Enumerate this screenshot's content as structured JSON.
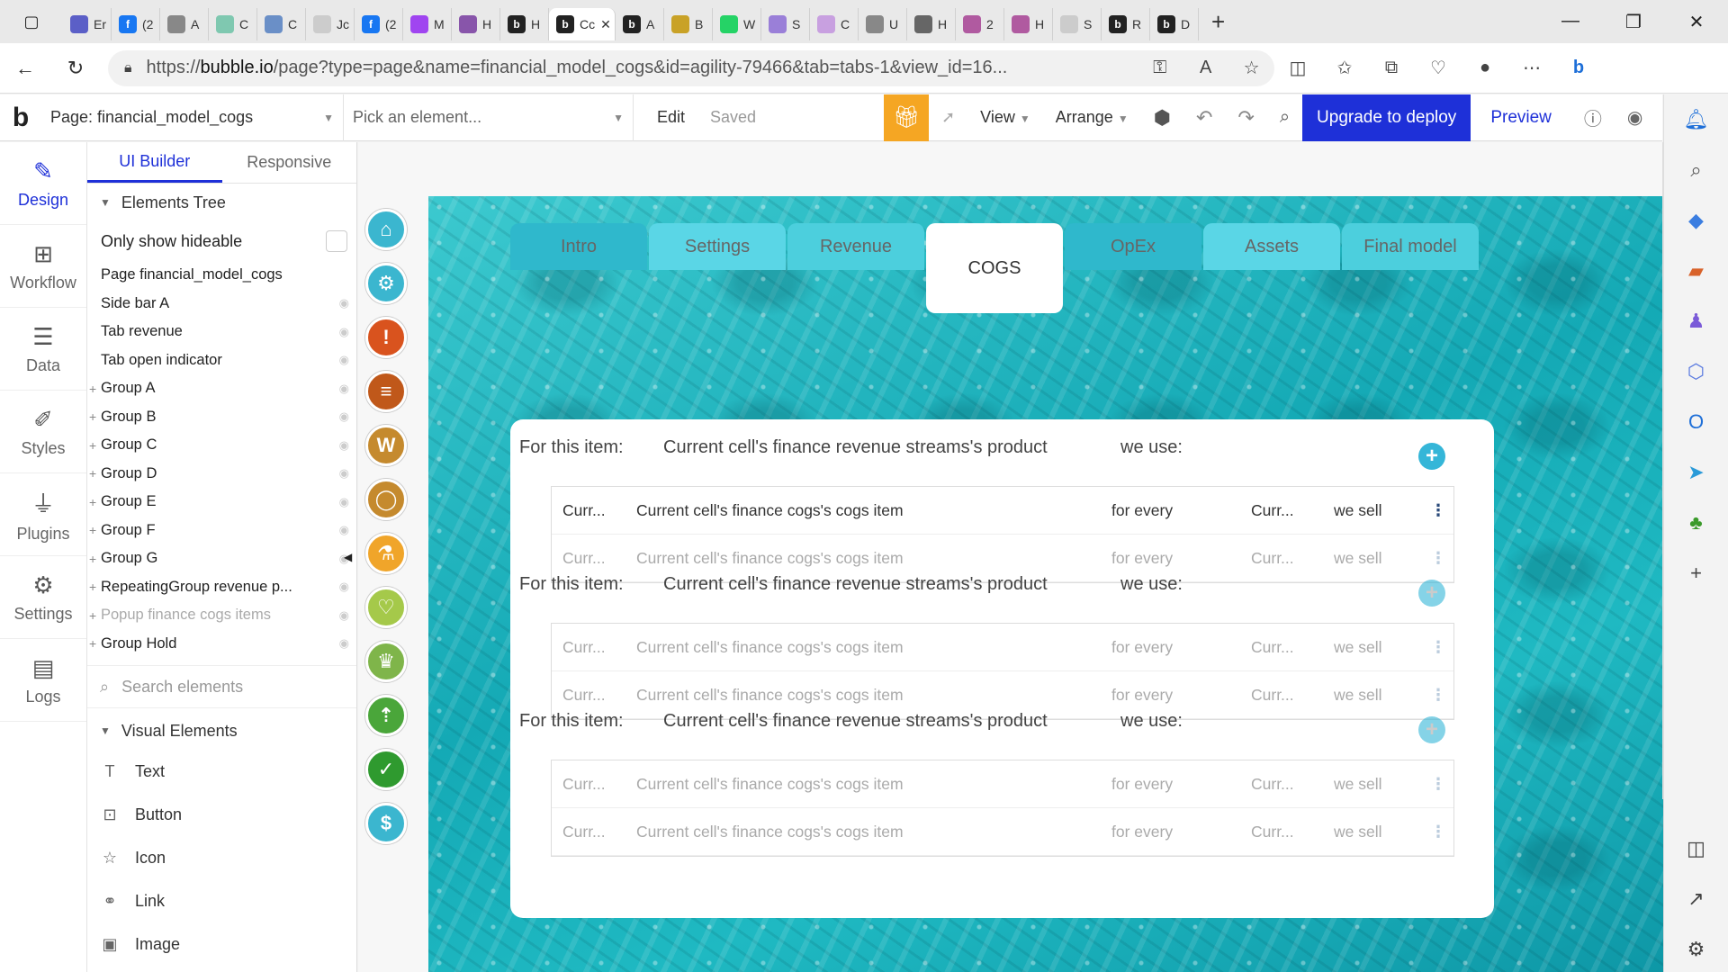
{
  "browser": {
    "tabs": [
      {
        "label": "Er",
        "icon": "teams-icon",
        "color": "#5b5fc7"
      },
      {
        "label": "(2",
        "icon": "facebook-icon",
        "color": "#1877f2"
      },
      {
        "label": "A",
        "icon": "doc-icon",
        "color": "#888888"
      },
      {
        "label": "C",
        "icon": "globe-icon",
        "color": "#7fc8b0"
      },
      {
        "label": "C",
        "icon": "app-icon",
        "color": "#6a8fc7"
      },
      {
        "label": "Jc",
        "icon": "blank-icon",
        "color": "#cccccc"
      },
      {
        "label": "(2",
        "icon": "facebook-icon",
        "color": "#1877f2"
      },
      {
        "label": "M",
        "icon": "messenger-icon",
        "color": "#a045f0"
      },
      {
        "label": "H",
        "icon": "app-icon",
        "color": "#8855aa"
      },
      {
        "label": "H",
        "icon": "bubble-icon",
        "color": "#222222"
      },
      {
        "label": "Cc",
        "icon": "bubble-icon",
        "color": "#222222",
        "active": true
      },
      {
        "label": "A",
        "icon": "bubble-icon",
        "color": "#222222"
      },
      {
        "label": "B",
        "icon": "app-icon",
        "color": "#c9a227"
      },
      {
        "label": "W",
        "icon": "whatsapp-icon",
        "color": "#25d366"
      },
      {
        "label": "S",
        "icon": "app-icon",
        "color": "#9a7fd8"
      },
      {
        "label": "C",
        "icon": "app-icon",
        "color": "#c8a0e0"
      },
      {
        "label": "U",
        "icon": "doc-icon",
        "color": "#888888"
      },
      {
        "label": "H",
        "icon": "app-icon",
        "color": "#666666"
      },
      {
        "label": "2",
        "icon": "app-icon",
        "color": "#b05aa0"
      },
      {
        "label": "H",
        "icon": "app-icon",
        "color": "#b05aa0"
      },
      {
        "label": "S",
        "icon": "app-icon",
        "color": "#cccccc"
      },
      {
        "label": "R",
        "icon": "bubble-icon",
        "color": "#222222"
      },
      {
        "label": "D",
        "icon": "bubble-icon",
        "color": "#222222"
      }
    ],
    "url_prefix": "https://",
    "url_domain": "bubble.io",
    "url_rest": "/page?type=page&name=financial_model_cogs&id=agility-79466&tab=tabs-1&view_id=16..."
  },
  "editor": {
    "page_select": "Page: financial_model_cogs",
    "element_picker": "Pick an element...",
    "edit": "Edit",
    "saved": "Saved",
    "view": "View",
    "arrange": "Arrange",
    "upgrade": "Upgrade to deploy",
    "preview": "Preview"
  },
  "rail": [
    {
      "label": "Design",
      "icon": "design-icon",
      "glyph": "✎",
      "active": true
    },
    {
      "label": "Workflow",
      "icon": "workflow-icon",
      "glyph": "⊞"
    },
    {
      "label": "Data",
      "icon": "database-icon",
      "glyph": "☰"
    },
    {
      "label": "Styles",
      "icon": "brush-icon",
      "glyph": "✐"
    },
    {
      "label": "Plugins",
      "icon": "plug-icon",
      "glyph": "⏚"
    },
    {
      "label": "Settings",
      "icon": "gear-icon",
      "glyph": "⚙"
    },
    {
      "label": "Logs",
      "icon": "logs-icon",
      "glyph": "▤"
    }
  ],
  "panel": {
    "tab_ui_builder": "UI Builder",
    "tab_responsive": "Responsive",
    "elements_tree": "Elements Tree",
    "only_show_hideable": "Only show hideable",
    "tree": [
      {
        "label": "Page financial_model_cogs",
        "plus": false,
        "eye": false
      },
      {
        "label": "Side bar A",
        "plus": false,
        "eye": true
      },
      {
        "label": "Tab revenue",
        "plus": false,
        "eye": true
      },
      {
        "label": "Tab open indicator",
        "plus": false,
        "eye": true
      },
      {
        "label": "Group A",
        "plus": true,
        "eye": true
      },
      {
        "label": "Group B",
        "plus": true,
        "eye": true
      },
      {
        "label": "Group C",
        "plus": true,
        "eye": true
      },
      {
        "label": "Group D",
        "plus": true,
        "eye": true
      },
      {
        "label": "Group E",
        "plus": true,
        "eye": true
      },
      {
        "label": "Group F",
        "plus": true,
        "eye": true
      },
      {
        "label": "Group G",
        "plus": true,
        "eye": true
      },
      {
        "label": "RepeatingGroup revenue p...",
        "plus": true,
        "eye": true
      },
      {
        "label": "Popup finance cogs items",
        "plus": true,
        "eye": true,
        "faded": true
      },
      {
        "label": "Group Hold",
        "plus": true,
        "eye": true
      }
    ],
    "search_placeholder": "Search elements",
    "visual_elements": "Visual Elements",
    "visual_items": [
      {
        "label": "Text",
        "icon": "text-icon",
        "glyph": "T"
      },
      {
        "label": "Button",
        "icon": "button-icon",
        "glyph": "⊡"
      },
      {
        "label": "Icon",
        "icon": "star-icon",
        "glyph": "☆"
      },
      {
        "label": "Link",
        "icon": "link-icon",
        "glyph": "⚭"
      },
      {
        "label": "Image",
        "icon": "image-icon",
        "glyph": "▣"
      }
    ]
  },
  "canvas": {
    "sidebar_icons": [
      {
        "icon": "home-icon",
        "glyph": "⌂",
        "color": "#3bb6cf"
      },
      {
        "icon": "gear-icon",
        "glyph": "⚙",
        "color": "#3bb6cf"
      },
      {
        "icon": "alert-icon",
        "glyph": "!",
        "color": "#d9531e"
      },
      {
        "icon": "list-icon",
        "glyph": "≡",
        "color": "#c0581a"
      },
      {
        "icon": "w-icon",
        "glyph": "W",
        "color": "#c58a2e"
      },
      {
        "icon": "chat-icon",
        "glyph": "◯",
        "color": "#c58a2e"
      },
      {
        "icon": "flask-icon",
        "glyph": "⚗",
        "color": "#f0a52a"
      },
      {
        "icon": "heart-icon",
        "glyph": "♡",
        "color": "#a5c94a"
      },
      {
        "icon": "trophy-icon",
        "glyph": "♛",
        "color": "#7fb54a"
      },
      {
        "icon": "road-icon",
        "glyph": "⇡",
        "color": "#4aa63a"
      },
      {
        "icon": "check-icon",
        "glyph": "✓",
        "color": "#2f9a2f"
      },
      {
        "icon": "dollar-icon",
        "glyph": "$",
        "color": "#3bb6cf"
      }
    ],
    "tabs": [
      {
        "label": "Intro",
        "style": "dim"
      },
      {
        "label": "Settings",
        "style": "light"
      },
      {
        "label": "Revenue",
        "style": "normal"
      },
      {
        "label": "COGS",
        "style": "active"
      },
      {
        "label": "OpEx",
        "style": "dim"
      },
      {
        "label": "Assets",
        "style": "light"
      },
      {
        "label": "Final model",
        "style": "normal"
      }
    ],
    "item_label": "For this item:",
    "item_product": "Current cell's finance revenue streams's product",
    "item_use": "we use:",
    "row": {
      "c1": "Curr...",
      "c2": "Current cell's finance cogs's cogs item",
      "c3": "for every",
      "c4": "Curr...",
      "c5": "we sell",
      "c6": "⋮"
    }
  }
}
